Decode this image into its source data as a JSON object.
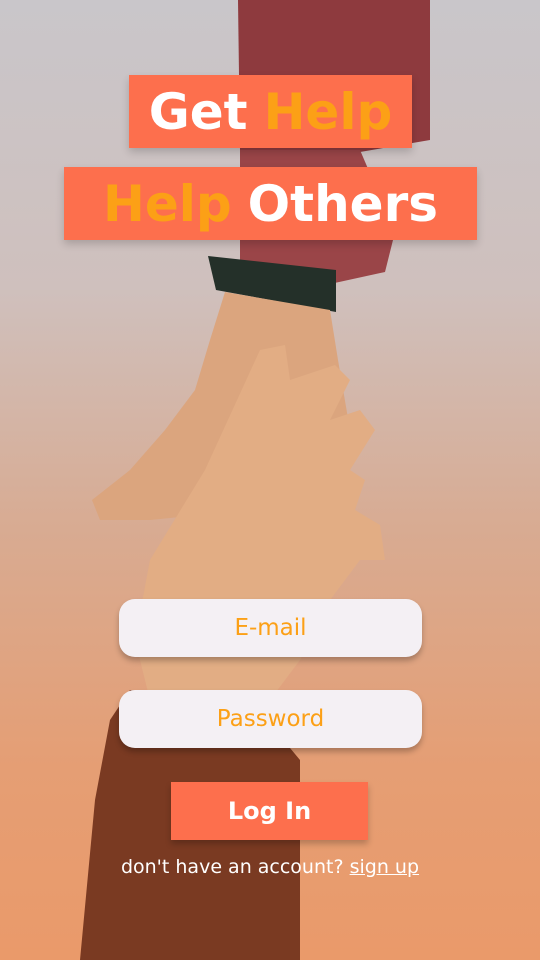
{
  "hero": {
    "line1": {
      "plain": "Get",
      "accent": "Help"
    },
    "line2": {
      "accent": "Help",
      "plain": "Others"
    }
  },
  "form": {
    "email": {
      "placeholder": "E-mail",
      "value": ""
    },
    "password": {
      "placeholder": "Password",
      "value": ""
    },
    "login_label": "Log In"
  },
  "signup": {
    "prompt": "don't have an account?",
    "link_label": "sign up"
  },
  "colors": {
    "brand_orange": "#fd6f4d",
    "accent_yellow": "#fca016",
    "field_bg": "#f4f0f4",
    "text_white": "#ffffff"
  },
  "background": {
    "image_subject": "two-hands-reaching-photo"
  }
}
